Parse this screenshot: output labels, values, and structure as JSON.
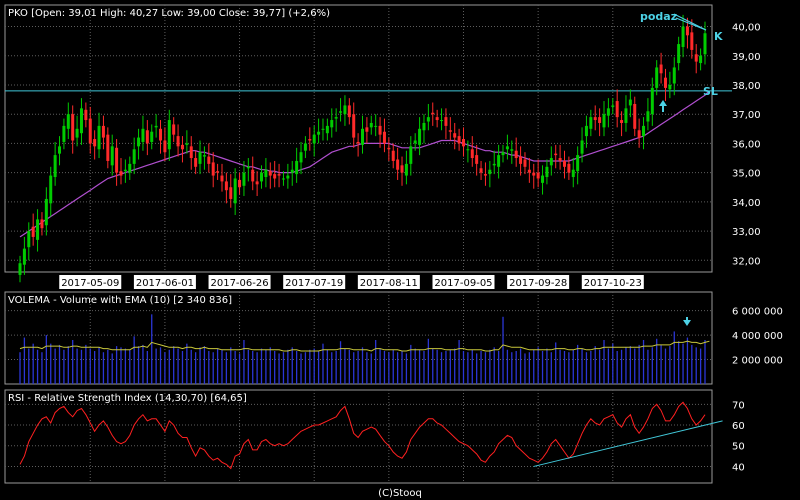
{
  "chart_data": [
    {
      "type": "candlestick",
      "title": "PKO [Open: 39,01  High: 40,27  Low: 39,00  Close: 39,77]  (+2,6%)",
      "ylim": [
        31.6,
        40.6
      ],
      "y_ticks": [
        "32,00",
        "33,00",
        "34,00",
        "35,00",
        "36,00",
        "37,00",
        "38,00",
        "39,00",
        "40,00"
      ],
      "y_tick_values": [
        32,
        33,
        34,
        35,
        36,
        37,
        38,
        39,
        40
      ],
      "x_ticks": [
        "2017-05-09",
        "2017-06-01",
        "2017-06-26",
        "2017-07-19",
        "2017-08-11",
        "2017-09-05",
        "2017-09-28",
        "2017-10-23"
      ],
      "x_tick_index": [
        16,
        33,
        50,
        67,
        84,
        101,
        118,
        135
      ],
      "close": [
        31.9,
        32.4,
        33.0,
        32.8,
        33.4,
        33.1,
        34.1,
        34.9,
        35.6,
        35.9,
        36.6,
        37.0,
        36.1,
        36.5,
        37.2,
        36.8,
        36.0,
        35.9,
        36.6,
        36.2,
        35.4,
        35.9,
        35.0,
        34.9,
        35.1,
        35.3,
        35.8,
        36.2,
        36.5,
        36.0,
        36.4,
        36.6,
        36.1,
        35.7,
        36.8,
        36.3,
        35.9,
        35.8,
        36.0,
        35.5,
        35.2,
        35.7,
        35.6,
        35.3,
        34.9,
        35.0,
        34.7,
        34.4,
        34.1,
        34.8,
        34.5,
        35.0,
        35.2,
        34.7,
        34.6,
        35.0,
        35.1,
        34.9,
        34.8,
        34.9,
        34.8,
        34.9,
        35.1,
        35.4,
        35.7,
        36.0,
        36.1,
        36.3,
        36.4,
        36.5,
        36.6,
        36.8,
        36.9,
        37.1,
        37.3,
        36.9,
        36.2,
        36.0,
        36.5,
        36.4,
        36.7,
        36.6,
        36.3,
        36.0,
        35.8,
        35.4,
        35.1,
        35.0,
        35.3,
        35.9,
        36.1,
        36.5,
        36.7,
        36.9,
        37.0,
        36.8,
        36.8,
        36.6,
        36.4,
        36.2,
        36.0,
        35.9,
        35.8,
        35.5,
        35.3,
        35.0,
        34.9,
        35.1,
        35.3,
        35.6,
        35.7,
        35.9,
        35.8,
        35.5,
        35.3,
        35.2,
        35.0,
        34.9,
        34.8,
        34.9,
        35.2,
        35.5,
        35.6,
        35.4,
        35.2,
        35.0,
        35.1,
        35.6,
        36.1,
        36.6,
        36.9,
        36.8,
        36.7,
        37.0,
        37.2,
        37.3,
        36.9,
        36.7,
        37.2,
        37.5,
        36.5,
        36.2,
        36.6,
        37.1,
        37.9,
        38.6,
        38.4,
        37.9,
        38.0,
        38.6,
        39.4,
        40.0,
        39.7,
        39.2,
        38.8,
        39.0,
        39.77
      ],
      "volume": [
        2.6,
        3.8,
        2.9,
        3.3,
        2.8,
        2.6,
        4.0,
        3.3,
        2.9,
        3.2,
        2.8,
        3.1,
        3.6,
        2.9,
        2.8,
        3.2,
        2.9,
        2.7,
        3.0,
        2.6,
        2.8,
        2.5,
        3.1,
        3.0,
        2.9,
        2.8,
        3.9,
        3.1,
        3.2,
        2.7,
        5.7,
        2.9,
        3.0,
        2.6,
        2.8,
        3.1,
        2.9,
        2.7,
        3.3,
        2.8,
        2.6,
        3.0,
        3.1,
        2.7,
        2.6,
        2.9,
        2.8,
        2.6,
        3.0,
        2.7,
        2.5,
        3.6,
        2.8,
        2.7,
        2.6,
        2.9,
        2.8,
        3.0,
        2.7,
        2.5,
        2.6,
        2.8,
        3.0,
        2.7,
        2.5,
        2.6,
        2.8,
        2.9,
        2.7,
        3.3,
        2.8,
        2.6,
        2.7,
        3.5,
        2.9,
        2.8,
        2.6,
        2.7,
        3.0,
        2.6,
        2.5,
        3.6,
        2.9,
        2.7,
        2.6,
        2.8,
        2.6,
        2.7,
        2.5,
        3.2,
        2.9,
        2.8,
        2.7,
        3.7,
        2.9,
        2.8,
        2.6,
        2.7,
        2.8,
        2.9,
        3.6,
        2.7,
        2.6,
        2.8,
        2.5,
        2.7,
        2.6,
        2.8,
        3.0,
        2.7,
        5.5,
        2.8,
        2.6,
        2.7,
        2.9,
        2.5,
        2.6,
        2.8,
        3.0,
        2.7,
        2.9,
        2.6,
        3.4,
        2.8,
        2.7,
        2.6,
        2.8,
        3.2,
        2.9,
        2.6,
        2.7,
        3.1,
        2.8,
        3.6,
        2.9,
        3.3,
        2.7,
        2.8,
        3.0,
        3.1,
        2.9,
        3.2,
        3.6,
        2.8,
        3.0,
        3.7,
        3.2,
        2.9,
        3.1,
        4.3,
        3.5,
        3.3,
        3.8,
        3.2,
        3.0,
        2.9,
        3.6,
        4.2
      ],
      "volume_ema": [
        2.9,
        3.0,
        3.0,
        3.0,
        3.0,
        2.9,
        3.1,
        3.1,
        3.1,
        3.1,
        3.0,
        3.0,
        3.1,
        3.1,
        3.0,
        3.0,
        3.0,
        3.0,
        3.0,
        2.9,
        2.9,
        2.8,
        2.8,
        2.8,
        2.8,
        2.8,
        3.0,
        3.0,
        3.1,
        3.0,
        3.4,
        3.3,
        3.2,
        3.1,
        3.0,
        3.0,
        3.0,
        2.9,
        3.0,
        3.0,
        2.9,
        2.9,
        3.0,
        2.9,
        2.9,
        2.9,
        2.8,
        2.8,
        2.8,
        2.8,
        2.8,
        2.9,
        2.9,
        2.8,
        2.8,
        2.8,
        2.8,
        2.8,
        2.8,
        2.8,
        2.7,
        2.7,
        2.8,
        2.8,
        2.7,
        2.7,
        2.7,
        2.7,
        2.7,
        2.8,
        2.8,
        2.8,
        2.8,
        2.9,
        2.9,
        2.9,
        2.8,
        2.8,
        2.8,
        2.8,
        2.7,
        2.9,
        2.9,
        2.8,
        2.8,
        2.8,
        2.8,
        2.7,
        2.7,
        2.8,
        2.8,
        2.8,
        2.8,
        2.9,
        2.9,
        2.9,
        2.9,
        2.8,
        2.8,
        2.8,
        2.9,
        2.9,
        2.8,
        2.8,
        2.8,
        2.8,
        2.7,
        2.7,
        2.8,
        2.8,
        3.2,
        3.1,
        3.0,
        3.0,
        3.0,
        2.9,
        2.8,
        2.8,
        2.8,
        2.8,
        2.8,
        2.8,
        2.9,
        2.9,
        2.9,
        2.8,
        2.8,
        2.9,
        2.9,
        2.8,
        2.8,
        2.9,
        2.9,
        3.0,
        3.0,
        3.0,
        3.0,
        3.0,
        3.0,
        3.0,
        3.0,
        3.0,
        3.1,
        3.1,
        3.1,
        3.2,
        3.2,
        3.2,
        3.2,
        3.4,
        3.4,
        3.4,
        3.5,
        3.4,
        3.4,
        3.3,
        3.4,
        3.5
      ],
      "ma": [
        32.8,
        32.9,
        33.0,
        33.1,
        33.2,
        33.3,
        33.4,
        33.5,
        33.6,
        33.7,
        33.8,
        33.9,
        34.0,
        34.1,
        34.2,
        34.3,
        34.4,
        34.5,
        34.6,
        34.7,
        34.8,
        34.85,
        34.9,
        34.95,
        35.0,
        35.05,
        35.1,
        35.15,
        35.2,
        35.25,
        35.3,
        35.35,
        35.4,
        35.45,
        35.5,
        35.55,
        35.6,
        35.65,
        35.7,
        35.75,
        35.75,
        35.7,
        35.7,
        35.65,
        35.6,
        35.55,
        35.5,
        35.45,
        35.4,
        35.35,
        35.3,
        35.25,
        35.2,
        35.2,
        35.15,
        35.1,
        35.1,
        35.05,
        35.05,
        35.0,
        35.0,
        35.0,
        35.0,
        35.05,
        35.1,
        35.15,
        35.2,
        35.3,
        35.4,
        35.5,
        35.6,
        35.7,
        35.75,
        35.8,
        35.85,
        35.9,
        35.9,
        35.95,
        36.0,
        36.0,
        36.0,
        36.0,
        36.0,
        36.0,
        36.0,
        35.95,
        35.9,
        35.85,
        35.85,
        35.85,
        35.85,
        35.85,
        35.9,
        35.95,
        36.0,
        36.05,
        36.1,
        36.1,
        36.1,
        36.1,
        36.05,
        36.0,
        35.95,
        35.9,
        35.85,
        35.8,
        35.75,
        35.75,
        35.7,
        35.7,
        35.7,
        35.65,
        35.6,
        35.6,
        35.55,
        35.5,
        35.45,
        35.4,
        35.4,
        35.4,
        35.4,
        35.4,
        35.4,
        35.4,
        35.4,
        35.4,
        35.45,
        35.5,
        35.55,
        35.6,
        35.65,
        35.7,
        35.75,
        35.8,
        35.85,
        35.9,
        35.95,
        36.0,
        36.05,
        36.1,
        36.15,
        36.2,
        36.25,
        36.35,
        36.45,
        36.55,
        36.65,
        36.75,
        36.85,
        36.95,
        37.05,
        37.15,
        37.25,
        37.35,
        37.45,
        37.55,
        37.65,
        37.8
      ],
      "ylevel_line": 37.8,
      "annotations": {
        "supply_label": "podaz",
        "k_label": "K",
        "sl_label": "SL"
      },
      "colors": {
        "up": "#00cc00",
        "down": "#ff2a2a",
        "ma": "#b04fcf",
        "hline": "#41c7d8",
        "annotation": "#4dd2e6"
      }
    },
    {
      "type": "bar",
      "title": "VOLEMA - Volume with EMA (10)  [2 340 836]",
      "ylim": [
        0,
        7.2
      ],
      "y_ticks": [
        "2 000 000",
        "4 000 000",
        "6 000 000"
      ],
      "y_tick_values": [
        2,
        4,
        6
      ],
      "colors": {
        "bar": "#2b36d6",
        "ema": "#c9c83b",
        "arrow": "#4dd2e6"
      }
    },
    {
      "type": "line",
      "title": "RSI - Relative Strength Index (14,30,70)  [64,65]",
      "ylim": [
        32,
        75
      ],
      "y_ticks": [
        "40",
        "50",
        "60",
        "70"
      ],
      "y_tick_values": [
        40,
        50,
        60,
        70
      ],
      "values": [
        41,
        45,
        52,
        56,
        60,
        63,
        64,
        61,
        66,
        68,
        69,
        66,
        64,
        67,
        68,
        65,
        61,
        57,
        60,
        62,
        59,
        55,
        52,
        51,
        52,
        55,
        60,
        63,
        65,
        62,
        63,
        63,
        60,
        57,
        62,
        60,
        56,
        54,
        54,
        49,
        45,
        49,
        48,
        45,
        43,
        44,
        42,
        41,
        39,
        45,
        46,
        51,
        53,
        48,
        48,
        52,
        53,
        51,
        50,
        51,
        50,
        51,
        53,
        55,
        57,
        58,
        59,
        60,
        60,
        61,
        62,
        63,
        64,
        67,
        69,
        63,
        56,
        54,
        57,
        58,
        59,
        58,
        55,
        52,
        50,
        47,
        45,
        44,
        47,
        53,
        56,
        59,
        61,
        63,
        63,
        61,
        60,
        58,
        56,
        54,
        52,
        51,
        50,
        48,
        46,
        43,
        42,
        45,
        47,
        51,
        53,
        55,
        54,
        50,
        48,
        46,
        44,
        43,
        42,
        44,
        47,
        51,
        53,
        50,
        47,
        44,
        46,
        51,
        56,
        60,
        63,
        61,
        60,
        63,
        64,
        65,
        61,
        59,
        63,
        65,
        59,
        56,
        59,
        63,
        68,
        70,
        67,
        62,
        62,
        65,
        69,
        71,
        68,
        63,
        60,
        62,
        65
      ],
      "trendline": [
        [
          117,
          40
        ],
        [
          160,
          62
        ]
      ],
      "colors": {
        "line": "#ff2020",
        "trend": "#41c7d8"
      }
    }
  ],
  "footer": "(C)Stooq"
}
